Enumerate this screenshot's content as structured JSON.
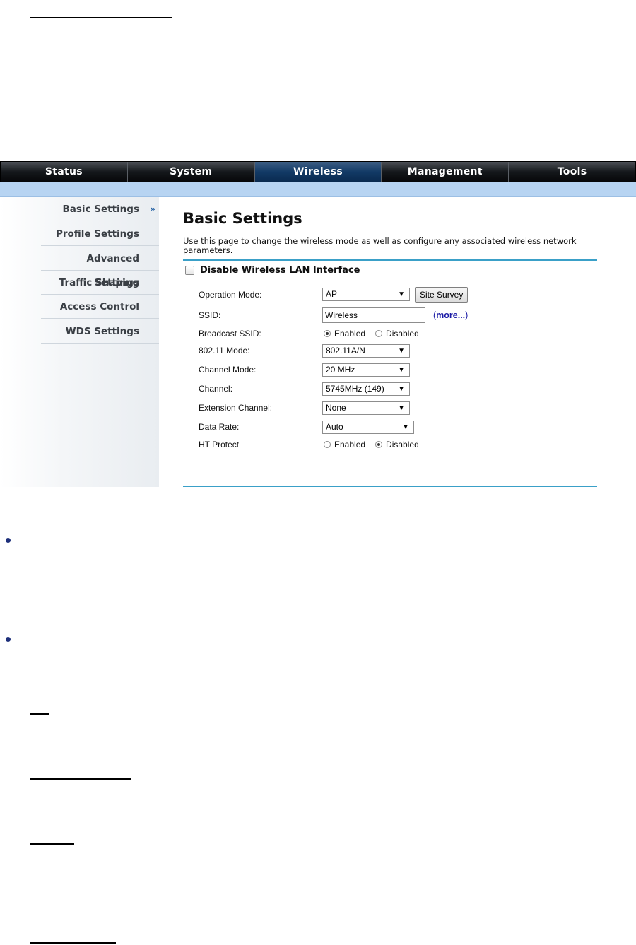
{
  "nav": {
    "tabs": [
      "Status",
      "System",
      "Wireless",
      "Management",
      "Tools"
    ],
    "active": "Wireless"
  },
  "sidebar": {
    "items": [
      {
        "label": "Basic Settings",
        "active": true
      },
      {
        "label": "Profile Settings"
      },
      {
        "label": "Advanced Settings"
      },
      {
        "label": "Traffic Shaping"
      },
      {
        "label": "Access Control"
      },
      {
        "label": "WDS Settings"
      }
    ],
    "active_marker": "»"
  },
  "page": {
    "title": "Basic Settings",
    "description": "Use this page to change the wireless mode as well as configure any associated wireless network parameters.",
    "disable_label": "Disable Wireless LAN Interface"
  },
  "form": {
    "operation_mode": {
      "label": "Operation Mode:",
      "value": "AP",
      "button": "Site Survey"
    },
    "ssid": {
      "label": "SSID:",
      "value": "Wireless",
      "more": "more..."
    },
    "broadcast_ssid": {
      "label": "Broadcast SSID:",
      "opt1": "Enabled",
      "opt2": "Disabled",
      "selected": "Enabled"
    },
    "mode_80211": {
      "label": "802.11 Mode:",
      "value": "802.11A/N"
    },
    "channel_mode": {
      "label": "Channel Mode:",
      "value": "20 MHz"
    },
    "channel": {
      "label": "Channel:",
      "value": "5745MHz (149)"
    },
    "extension_channel": {
      "label": "Extension Channel:",
      "value": "None"
    },
    "data_rate": {
      "label": "Data Rate:",
      "value": "Auto"
    },
    "ht_protect": {
      "label": "HT Protect",
      "opt1": "Enabled",
      "opt2": "Disabled",
      "selected": "Disabled"
    }
  },
  "colors": {
    "nav_active": "#123a66",
    "sub_strip": "#b7d4f2",
    "rule": "#3aa0c8",
    "link": "#1a1aa6"
  }
}
